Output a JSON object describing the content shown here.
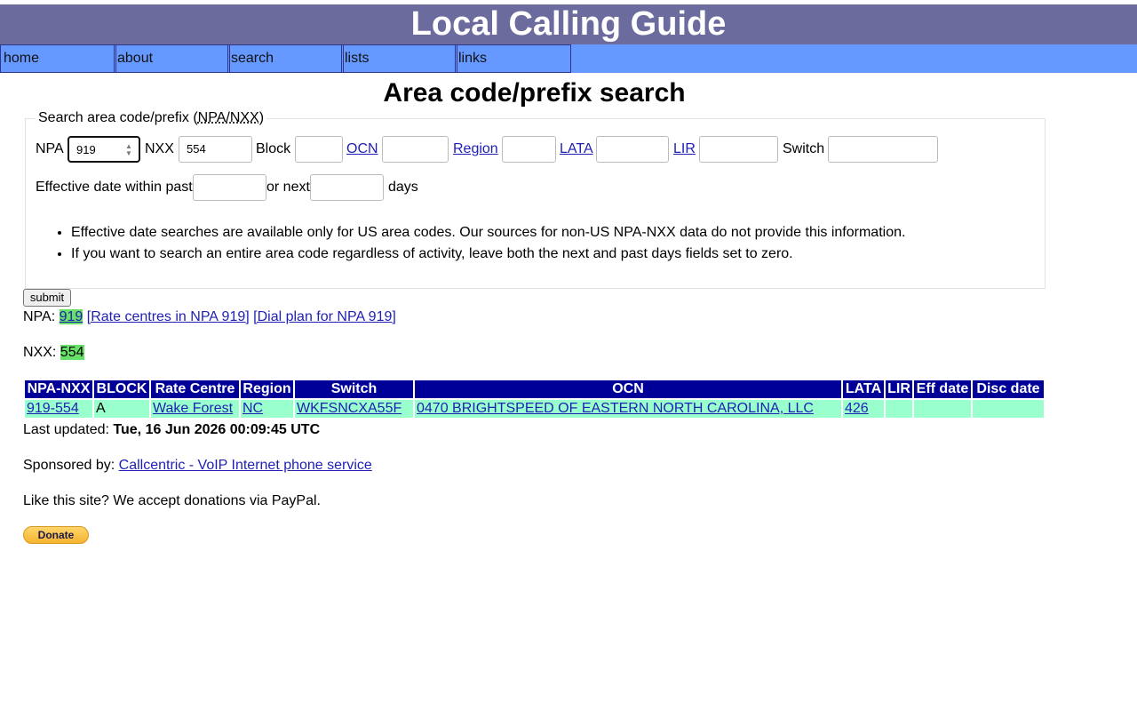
{
  "header": {
    "title": "Local Calling Guide"
  },
  "nav": {
    "items": [
      "home",
      "about",
      "search",
      "lists",
      "links"
    ]
  },
  "page": {
    "title": "Area code/prefix search"
  },
  "form": {
    "legend_prefix": "Search area code/prefix (",
    "legend_abbr": "NPA/NXX",
    "legend_suffix": ")",
    "npa_label": "NPA",
    "npa_value": "919",
    "nxx_label": "NXX",
    "nxx_value": "554",
    "block_label": "Block",
    "ocn_label": "OCN",
    "region_label": "Region",
    "lata_label": "LATA",
    "lir_label": "LIR",
    "switch_label": "Switch",
    "eff_label": "Effective date within past",
    "or_next_label": "or next",
    "days_label": "days",
    "notes": [
      "Effective date searches are available only for US area codes. Our sources for non-US NPA-NXX data do not provide this information.",
      "If you want to search an entire area code regardless of activity, leave both the next and past days fields set to zero."
    ],
    "submit_label": "submit"
  },
  "npa_line": {
    "label": "NPA:",
    "value": "919",
    "rate_centres_link": "[Rate centres in NPA 919]",
    "dial_plan_link": "[Dial plan for NPA 919]"
  },
  "nxx_line": {
    "label": "NXX:",
    "value": "554"
  },
  "table": {
    "headers": [
      "NPA-NXX",
      "BLOCK",
      "Rate Centre",
      "Region",
      "Switch",
      "OCN",
      "LATA",
      "LIR",
      "Eff date",
      "Disc date"
    ],
    "row": {
      "npa_nxx": "919-554",
      "block": "A",
      "rate_centre": "Wake Forest",
      "region": "NC",
      "switch": "WKFSNCXA55F",
      "ocn": "0470 BRIGHTSPEED OF EASTERN NORTH CAROLINA, LLC",
      "lata": "426",
      "lir": "",
      "eff_date": "",
      "disc_date": ""
    }
  },
  "footer": {
    "updated_label": "Last updated:",
    "updated_value": "Tue, 16 Jun 2026 00:09:45 UTC",
    "sponsor_label": "Sponsored by:",
    "sponsor_link": "Callcentric - VoIP Internet phone service",
    "donate_text": "Like this site? We accept donations via PayPal.",
    "donate_button": "Donate"
  },
  "colors": {
    "header_bg": "#6b6b9e",
    "nav_bg": "#6699ff",
    "table_header_bg": "#000099",
    "table_row_bg": "#99ffcc",
    "highlight": "#66e066"
  }
}
